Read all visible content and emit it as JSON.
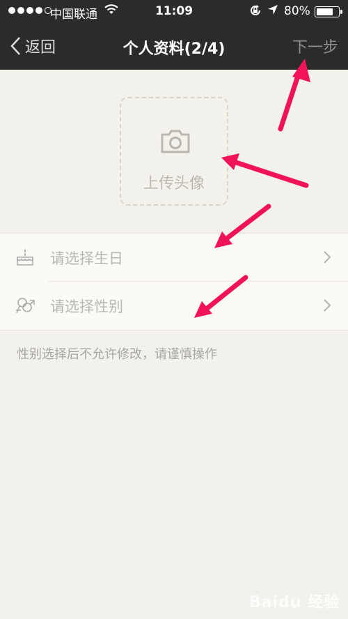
{
  "status": {
    "carrier": "中国联通",
    "time": "11:09",
    "battery": "80%",
    "battery_level": 0.8
  },
  "nav": {
    "back": "返回",
    "title": "个人资料(2/4)",
    "next": "下一步"
  },
  "avatar": {
    "label": "上传头像",
    "icon": "camera-icon"
  },
  "rows": [
    {
      "label": "请选择生日",
      "icon": "cake-icon"
    },
    {
      "label": "请选择性别",
      "icon": "gender-icon"
    }
  ],
  "note": "性别选择后不允许修改，请谨慎操作",
  "watermark": "Baidu 经验",
  "colors": {
    "header": "#2b2b2b",
    "background": "#f3f1eb",
    "annotation_arrow": "#f0135a"
  }
}
